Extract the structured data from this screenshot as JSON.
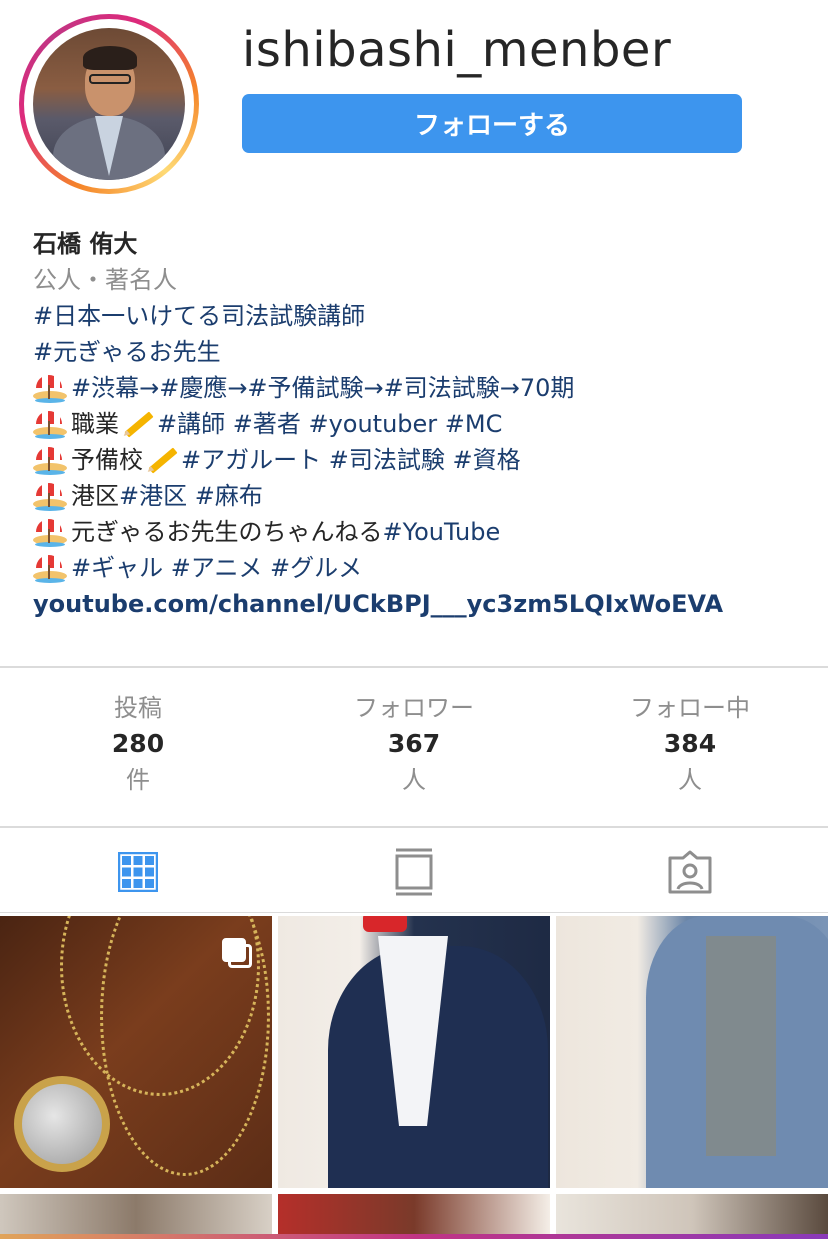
{
  "profile": {
    "username": "ishibashi_menber",
    "follow_label": "フォローする",
    "name": "石橋 侑大",
    "category": "公人・著名人"
  },
  "bio": {
    "line1": "#日本一いけてる司法試験講師",
    "line2": "#元ぎゃるお先生",
    "line3": "#渋幕→#慶應→#予備試験→#司法試験→70期",
    "line4a": "職業",
    "line4b": "#講師 #著者 #youtuber #MC",
    "line5a": "予備校",
    "line5b": "#アガルート #司法試験 #資格",
    "line6a": "港区 ",
    "line6b": "#港区 #麻布",
    "line7a": "元ぎゃるお先生のちゃんねる ",
    "line7b": "#YouTube",
    "line8": "#ギャル #アニメ #グルメ",
    "link": "youtube.com/channel/UCkBPJ___yc3zm5LQIxWoEVA"
  },
  "stats": {
    "posts": {
      "label": "投稿",
      "value": "280",
      "unit": "件"
    },
    "followers": {
      "label": "フォロワー",
      "value": "367",
      "unit": "人"
    },
    "following": {
      "label": "フォロー中",
      "value": "384",
      "unit": "人"
    }
  },
  "tabs": {
    "grid": "grid-icon",
    "feed": "feed-icon",
    "tagged": "tagged-icon",
    "active_color": "#3d95ee",
    "inactive_color": "#8e8e8e"
  },
  "colors": {
    "follow_button": "#3d95ee",
    "hashtag": "#1b3d6e",
    "muted": "#8e8e8e"
  }
}
